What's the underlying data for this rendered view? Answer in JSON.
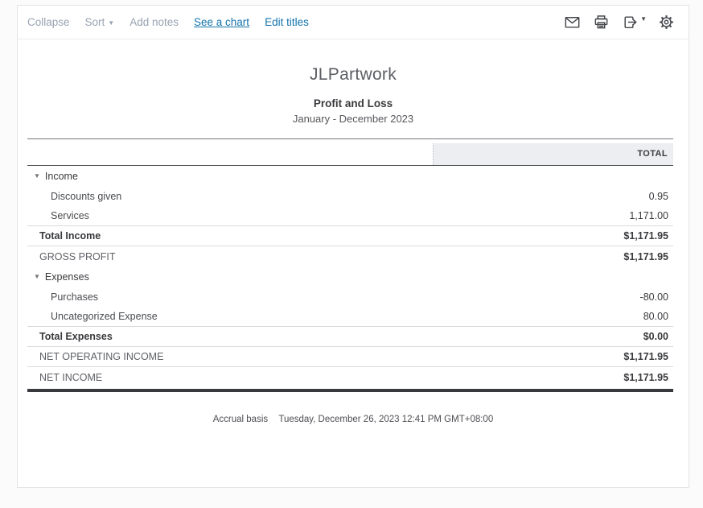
{
  "toolbar": {
    "links": [
      {
        "label": "Collapse"
      },
      {
        "label": "Sort"
      },
      {
        "label": "Add notes"
      },
      {
        "label": "See a chart"
      },
      {
        "label": "Edit titles"
      }
    ]
  },
  "report": {
    "company": "JLPartwork",
    "title": "Profit and Loss",
    "period": "January - December 2023"
  },
  "table": {
    "total_header": "TOTAL",
    "rows": [
      {
        "label": "Income",
        "value": "",
        "type": "section"
      },
      {
        "label": "Discounts given",
        "value": "0.95",
        "type": "child"
      },
      {
        "label": "Services",
        "value": "1,171.00",
        "type": "child"
      },
      {
        "label": "Total Income",
        "value": "$1,171.95",
        "type": "total"
      },
      {
        "label": "GROSS PROFIT",
        "value": "$1,171.95",
        "type": "summary"
      },
      {
        "label": "Expenses",
        "value": "",
        "type": "section"
      },
      {
        "label": "Purchases",
        "value": "-80.00",
        "type": "child"
      },
      {
        "label": "Uncategorized Expense",
        "value": "80.00",
        "type": "child"
      },
      {
        "label": "Total Expenses",
        "value": "$0.00",
        "type": "total"
      },
      {
        "label": "NET OPERATING INCOME",
        "value": "$1,171.95",
        "type": "summary"
      },
      {
        "label": "NET INCOME",
        "value": "$1,171.95",
        "type": "summary"
      }
    ]
  },
  "footer": {
    "basis": "Accrual basis",
    "timestamp": "Tuesday, December 26, 2023   12:41 PM GMT+08:00"
  },
  "colors": {
    "accent": "#1474ad",
    "muted_link": "#98a3b1",
    "text": "#393a3d",
    "header_shade": "#eceef1"
  }
}
